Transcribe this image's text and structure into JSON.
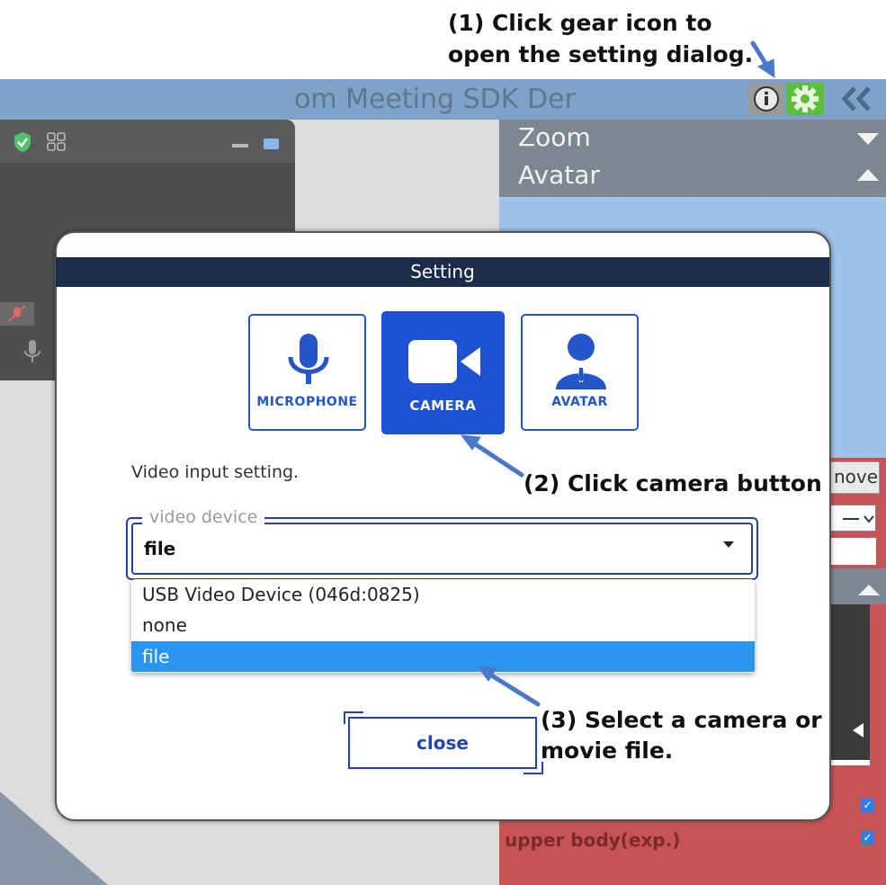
{
  "annotations": {
    "step1_line1": "(1) Click gear icon to",
    "step1_line2": "open the setting dialog.",
    "step2": "(2) Click camera button",
    "step3_line1": "(3) Select a camera or",
    "step3_line2": "movie file."
  },
  "appbar": {
    "title": "om Meeting SDK Der",
    "info_icon": "info-icon",
    "gear_icon": "gear-icon",
    "collapse_icon": "double-chevron-left-icon"
  },
  "right_panel": {
    "zoom_label": "Zoom",
    "avatar_label": "Avatar",
    "move_partial": "nove",
    "upper_body_label": "upper body(exp.)"
  },
  "dialog": {
    "title": "Setting",
    "tabs": [
      {
        "label": "MICROPHONE",
        "icon": "microphone-icon",
        "active": false
      },
      {
        "label": "CAMERA",
        "icon": "video-camera-icon",
        "active": true
      },
      {
        "label": "AVATAR",
        "icon": "person-icon",
        "active": false
      }
    ],
    "section_text": "Video input setting.",
    "select": {
      "legend": "video device",
      "value": "file"
    },
    "options": [
      {
        "label": "USB Video Device (046d:0825)",
        "selected": false
      },
      {
        "label": "none",
        "selected": false
      },
      {
        "label": "file",
        "selected": true
      }
    ],
    "close_label": "close"
  },
  "colors": {
    "accent": "#1f52d2",
    "appbar": "#7fa2c8",
    "dialog_header": "#1b2b4c",
    "selected_option": "#2a96f0",
    "annotation_arrow": "#4a78c8"
  }
}
